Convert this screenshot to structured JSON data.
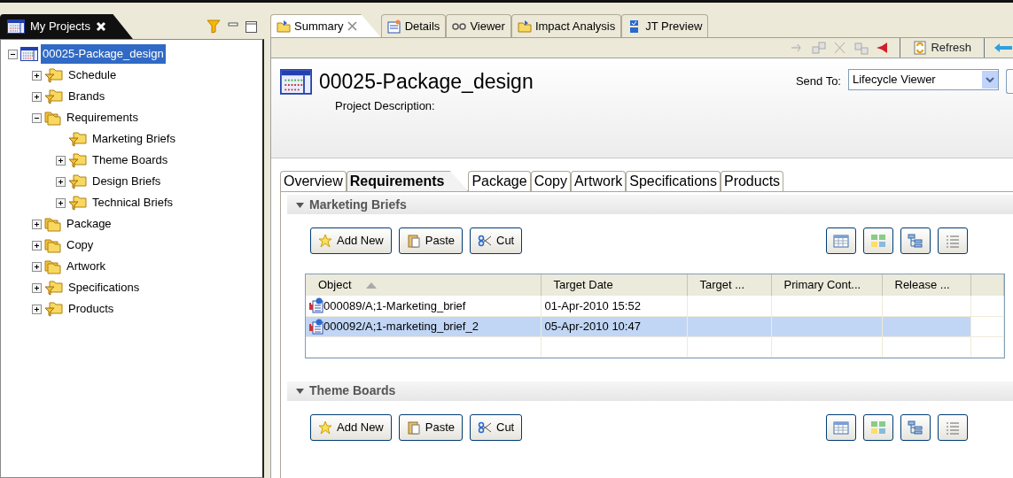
{
  "projects_view": {
    "title": "My Projects",
    "tree": [
      {
        "label": "00025-Package_design",
        "kind": "project",
        "expanded": true,
        "selected": true,
        "children": [
          {
            "label": "Schedule",
            "kind": "query",
            "expanded": false,
            "selected": false
          },
          {
            "label": "Brands",
            "kind": "query",
            "expanded": false,
            "selected": false
          },
          {
            "label": "Requirements",
            "kind": "folder",
            "expanded": true,
            "selected": false,
            "children": [
              {
                "label": "Marketing Briefs",
                "kind": "query",
                "selected": false
              },
              {
                "label": "Theme Boards",
                "kind": "query",
                "expanded": false,
                "selected": false
              },
              {
                "label": "Design Briefs",
                "kind": "query",
                "expanded": false,
                "selected": false
              },
              {
                "label": "Technical Briefs",
                "kind": "query",
                "expanded": false,
                "selected": false
              }
            ]
          },
          {
            "label": "Package",
            "kind": "folder",
            "expanded": false,
            "selected": false
          },
          {
            "label": "Copy",
            "kind": "folder",
            "expanded": false,
            "selected": false
          },
          {
            "label": "Artwork",
            "kind": "folder",
            "expanded": false,
            "selected": false
          },
          {
            "label": "Specifications",
            "kind": "query",
            "expanded": false,
            "selected": false
          },
          {
            "label": "Products",
            "kind": "query",
            "expanded": false,
            "selected": false
          }
        ]
      }
    ]
  },
  "editor_tabs": [
    {
      "label": "Summary",
      "kind": "summary",
      "selected": true,
      "closable": true
    },
    {
      "label": "Details",
      "kind": "details",
      "selected": false,
      "closable": false
    },
    {
      "label": "Viewer",
      "kind": "viewer",
      "selected": false,
      "closable": false
    },
    {
      "label": "Impact Analysis",
      "kind": "impact",
      "selected": false,
      "closable": false
    },
    {
      "label": "JT Preview",
      "kind": "jt",
      "selected": false,
      "closable": false
    }
  ],
  "toolbar": {
    "refresh": "Refresh"
  },
  "header": {
    "title": "00025-Package_design",
    "description_label": "Project Description:",
    "send_to_label": "Send To:",
    "send_to_value": "Lifecycle Viewer"
  },
  "form_tabs": [
    {
      "label": "Overview",
      "selected": false
    },
    {
      "label": "Requirements",
      "selected": true
    },
    {
      "label": "Package",
      "selected": false
    },
    {
      "label": "Copy",
      "selected": false
    },
    {
      "label": "Artwork",
      "selected": false
    },
    {
      "label": "Specifications",
      "selected": false
    },
    {
      "label": "Products",
      "selected": false
    }
  ],
  "sections": [
    {
      "title": "Marketing Briefs",
      "expanded": true,
      "buttons": [
        {
          "kind": "add",
          "label": "Add New"
        },
        {
          "kind": "paste",
          "label": "Paste"
        },
        {
          "kind": "cut",
          "label": "Cut"
        }
      ],
      "table": {
        "columns": [
          {
            "label": "Object",
            "sorted": true
          },
          {
            "label": "Target Date",
            "sorted": false
          },
          {
            "label": "Target ...",
            "sorted": false
          },
          {
            "label": "Primary Cont...",
            "sorted": false
          },
          {
            "label": "Release ...",
            "sorted": false
          }
        ],
        "rows": [
          {
            "cells": [
              "000089/A;1-Marketing_brief",
              "01-Apr-2010 15:52"
            ],
            "selected": false
          },
          {
            "cells": [
              "000092/A;1-marketing_brief_2",
              "05-Apr-2010 10:47"
            ],
            "selected": true
          }
        ]
      }
    },
    {
      "title": "Theme Boards",
      "expanded": true,
      "buttons": [
        {
          "kind": "add",
          "label": "Add New"
        },
        {
          "kind": "paste",
          "label": "Paste"
        },
        {
          "kind": "cut",
          "label": "Cut"
        }
      ]
    }
  ]
}
